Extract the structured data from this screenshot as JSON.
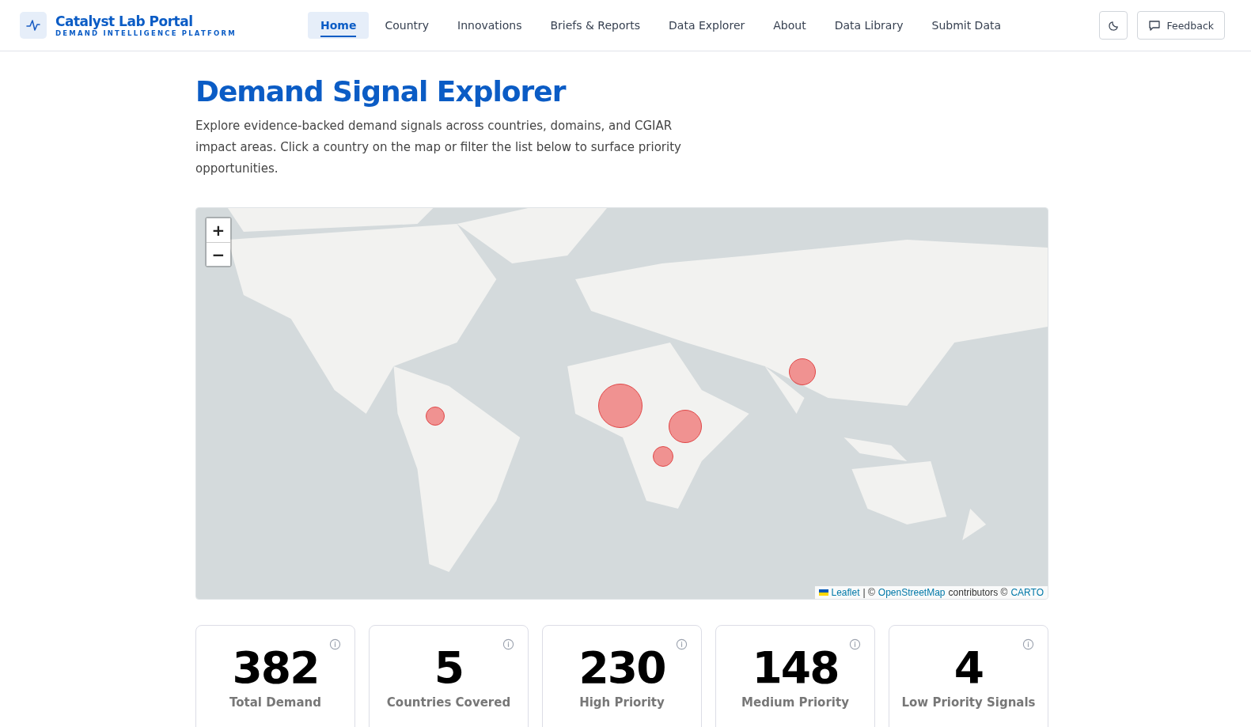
{
  "brand": {
    "title": "Catalyst Lab Portal",
    "subtitle": "DEMAND INTELLIGENCE PLATFORM"
  },
  "nav": [
    {
      "label": "Home",
      "selected": true
    },
    {
      "label": "Country",
      "selected": false
    },
    {
      "label": "Innovations",
      "selected": false
    },
    {
      "label": "Briefs & Reports",
      "selected": false
    },
    {
      "label": "Data Explorer",
      "selected": false
    },
    {
      "label": "About",
      "selected": false
    },
    {
      "label": "Data Library",
      "selected": false
    },
    {
      "label": "Submit Data",
      "selected": false
    }
  ],
  "feedback_button": "Feedback",
  "page": {
    "title": "Demand Signal Explorer",
    "description": "Explore evidence-backed demand signals across countries, domains, and CGIAR impact areas. Click a country on the map or filter the list below to surface priority opportunities."
  },
  "map": {
    "zoom_in": "+",
    "zoom_out": "−",
    "attribution": [
      {
        "text": "Leaflet",
        "link": true
      },
      {
        "text": "| ©",
        "link": false
      },
      {
        "text": "OpenStreetMap",
        "link": true
      },
      {
        "text": "contributors ©",
        "link": false
      },
      {
        "text": "CARTO",
        "link": true
      }
    ]
  },
  "stats": [
    {
      "value": "382",
      "label": "Total Demand"
    },
    {
      "value": "5",
      "label": "Countries Covered"
    },
    {
      "value": "230",
      "label": "High Priority"
    },
    {
      "value": "148",
      "label": "Medium Priority"
    },
    {
      "value": "4",
      "label": "Low Priority Signals"
    }
  ]
}
